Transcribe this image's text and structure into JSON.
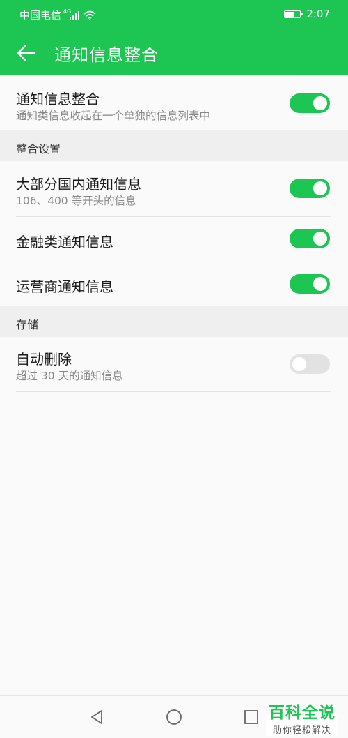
{
  "status_bar": {
    "carrier": "中国电信",
    "network": "4G",
    "time": "2:07"
  },
  "app_bar": {
    "title": "通知信息整合"
  },
  "main_toggle": {
    "title": "通知信息整合",
    "subtitle": "通知类信息收起在一个单独的信息列表中",
    "enabled": true
  },
  "sections": [
    {
      "header": "整合设置",
      "items": [
        {
          "title": "大部分国内通知信息",
          "subtitle": "106、400 等开头的信息",
          "enabled": true
        },
        {
          "title": "金融类通知信息",
          "subtitle": "",
          "enabled": true
        },
        {
          "title": "运营商通知信息",
          "subtitle": "",
          "enabled": true
        }
      ]
    },
    {
      "header": "存储",
      "items": [
        {
          "title": "自动删除",
          "subtitle": "超过 30 天的通知信息",
          "enabled": false
        }
      ]
    }
  ],
  "watermark": {
    "title": "百科全说",
    "tagline": "助你轻松解决"
  },
  "colors": {
    "accent": "#1dc553",
    "switch_off": "#e2e2e2",
    "section_bg": "#efefef"
  }
}
